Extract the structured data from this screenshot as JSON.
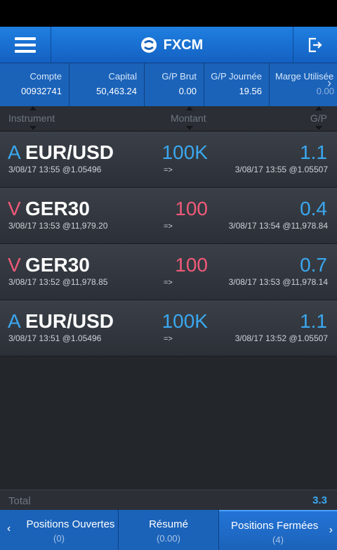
{
  "app": {
    "title": "FXCM"
  },
  "summary": [
    {
      "label": "Compte",
      "value": "00932741"
    },
    {
      "label": "Capital",
      "value": "50,463.24"
    },
    {
      "label": "G/P Brut",
      "value": "0.00"
    },
    {
      "label": "G/P Journée",
      "value": "19.56"
    },
    {
      "label": "Marge Utilisée",
      "value": "0.00"
    }
  ],
  "columns": {
    "instrument": "Instrument",
    "amount": "Montant",
    "pl": "G/P"
  },
  "rows": [
    {
      "side": "A",
      "symbol": "EUR/USD",
      "amount": "100K",
      "pl": "1.1",
      "open": "3/08/17 13:55 @1.05496",
      "arrow": "=>",
      "close": "3/08/17 13:55 @1.05507"
    },
    {
      "side": "V",
      "symbol": "GER30",
      "amount": "100",
      "pl": "0.4",
      "open": "3/08/17 13:53 @11,979.20",
      "arrow": "=>",
      "close": "3/08/17 13:54 @11,978.84"
    },
    {
      "side": "V",
      "symbol": "GER30",
      "amount": "100",
      "pl": "0.7",
      "open": "3/08/17 13:52 @11,978.85",
      "arrow": "=>",
      "close": "3/08/17 13:53 @11,978.14"
    },
    {
      "side": "A",
      "symbol": "EUR/USD",
      "amount": "100K",
      "pl": "1.1",
      "open": "3/08/17 13:51 @1.05496",
      "arrow": "=>",
      "close": "3/08/17 13:52 @1.05507"
    }
  ],
  "total": {
    "label": "Total",
    "value": "3.3"
  },
  "tabs": [
    {
      "label": "Positions Ouvertes",
      "count": "(0)"
    },
    {
      "label": "Résumé",
      "count": "(0.00)"
    },
    {
      "label": "Positions Fermées",
      "count": "(4)"
    }
  ],
  "colors": {
    "buy": "#3aa8f0",
    "sell": "#f05a78",
    "header": "#1b63b9"
  },
  "icons": {
    "menu": "hamburger-icon",
    "logo": "fxcm-logo-icon",
    "logout": "logout-icon"
  }
}
